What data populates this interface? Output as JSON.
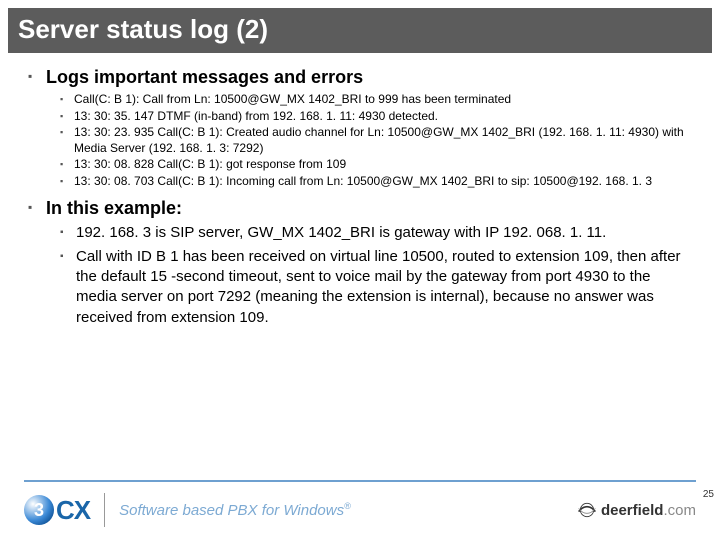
{
  "title": "Server status log (2)",
  "section1": {
    "heading": "Logs important messages and errors",
    "items": [
      "Call(C: B 1): Call from Ln: 10500@GW_MX 1402_BRI to 999 has been terminated",
      "13: 30: 35. 147 DTMF (in-band) from 192. 168. 1. 11: 4930 detected.",
      "13: 30: 23. 935 Call(C: B 1): Created audio channel for Ln: 10500@GW_MX 1402_BRI (192. 168. 1. 11: 4930) with Media Server (192. 168. 1. 3: 7292)",
      "13: 30: 08. 828 Call(C: B 1): got response from 109",
      "13: 30: 08. 703 Call(C: B 1): Incoming call from Ln: 10500@GW_MX 1402_BRI to sip: 10500@192. 168. 1. 3"
    ]
  },
  "section2": {
    "heading": "In this example:",
    "items": [
      "192. 168. 3 is SIP server, GW_MX 1402_BRI is gateway with IP 192. 068. 1. 11.",
      "Call with ID B 1 has been received on virtual line 10500, routed to extension 109, then after the default 15 -second timeout, sent to voice mail by the gateway from port 4930 to the media server on port 7292 (meaning the extension is internal), because no answer was received from extension 109."
    ]
  },
  "footer": {
    "logo_ball": "3",
    "logo_text": "CX",
    "tagline": "Software based PBX for Windows",
    "tagline_reg": "®",
    "deerfield": "deerfield",
    "deerfield_suffix": ".com",
    "page": "25"
  }
}
